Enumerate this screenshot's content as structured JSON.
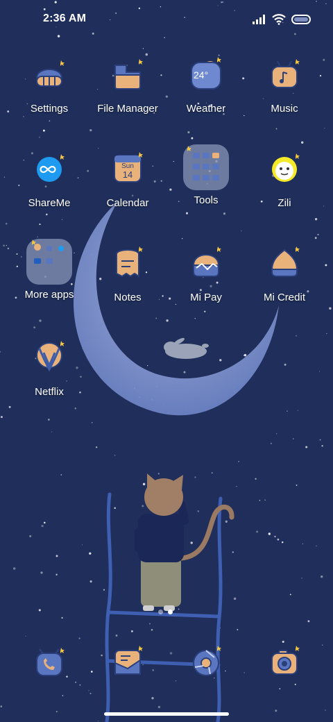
{
  "status_bar": {
    "time": "2:36 AM",
    "icons": [
      "signal-icon",
      "wifi-icon",
      "battery-icon"
    ]
  },
  "apps": [
    {
      "label": "Settings",
      "icon": "settings-icon"
    },
    {
      "label": "File Manager",
      "icon": "file-manager-icon"
    },
    {
      "label": "Weather",
      "icon": "weather-icon",
      "badge_text": "24°"
    },
    {
      "label": "Music",
      "icon": "music-icon"
    },
    {
      "label": "ShareMe",
      "icon": "shareme-icon"
    },
    {
      "label": "Calendar",
      "icon": "calendar-icon",
      "day": "Sun",
      "date": "14"
    },
    {
      "label": "Tools",
      "icon": "folder-icon"
    },
    {
      "label": "Zili",
      "icon": "zili-icon"
    },
    {
      "label": "More apps",
      "icon": "folder-icon"
    },
    {
      "label": "Notes",
      "icon": "notes-icon"
    },
    {
      "label": "Mi Pay",
      "icon": "mi-pay-icon"
    },
    {
      "label": "Mi Credit",
      "icon": "mi-credit-icon"
    },
    {
      "label": "Netflix",
      "icon": "netflix-icon"
    }
  ],
  "dock": [
    {
      "icon": "phone-icon"
    },
    {
      "icon": "messages-icon"
    },
    {
      "icon": "browser-icon"
    },
    {
      "icon": "camera-icon"
    }
  ],
  "page_indicator": {
    "pages": 2,
    "current": 2
  },
  "colors": {
    "background": "#1f2e5a",
    "icon_orange": "#e8b27a",
    "icon_blue": "#5b76c0",
    "icon_outline": "#2a3f7a",
    "moon": "#8ea0d3"
  }
}
